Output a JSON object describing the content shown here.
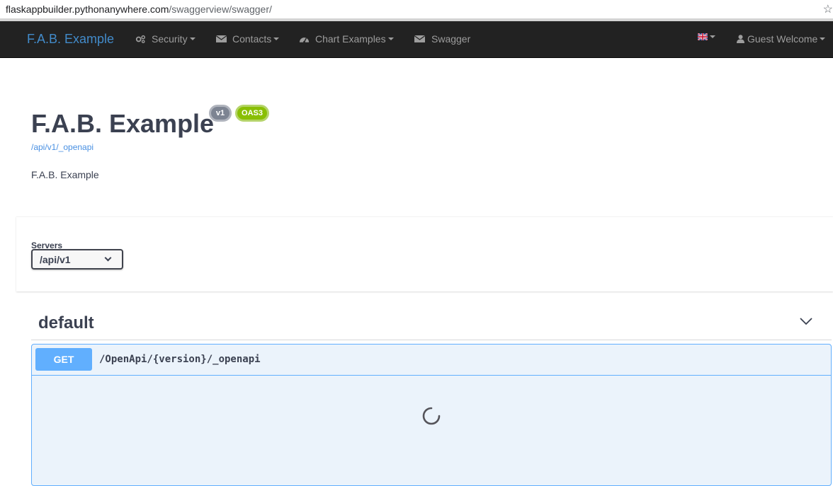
{
  "browser": {
    "url_host": "flaskappbuilder.pythonanywhere.com",
    "url_path": "/swaggerview/swagger/"
  },
  "navbar": {
    "brand": "F.A.B. Example",
    "items": [
      {
        "label": "Security",
        "icon": "gears-icon"
      },
      {
        "label": "Contacts",
        "icon": "envelope-icon"
      },
      {
        "label": "Chart Examples",
        "icon": "dashboard-icon"
      },
      {
        "label": "Swagger",
        "icon": "envelope-icon"
      }
    ],
    "language_icon": "uk-flag-icon",
    "user_label": "Guest Welcome"
  },
  "info": {
    "title": "F.A.B. Example",
    "version_badge": "v1",
    "oas_badge": "OAS3",
    "spec_link": "/api/v1/_openapi",
    "description": "F.A.B. Example"
  },
  "servers": {
    "label": "Servers",
    "selected": "/api/v1"
  },
  "tag": {
    "name": "default"
  },
  "operation": {
    "method": "GET",
    "path": "/OpenApi/{version}/_openapi",
    "method_color": "#61affe"
  }
}
